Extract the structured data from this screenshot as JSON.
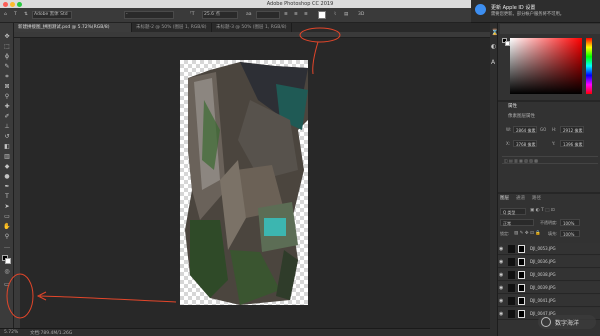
{
  "app": {
    "window_title": "Adobe Photoshop CC 2019"
  },
  "options_bar": {
    "mode_label": "Adobe 黑体 Std",
    "font_style": "-",
    "size_value": "25.6 点"
  },
  "tabs": [
    {
      "label": "新建拼接图_拼图测试.psd @ 5.72%(RGB/8)",
      "active": true
    },
    {
      "label": "未标题-2 @ 50% (图层 1, RGB/8)",
      "active": false
    },
    {
      "label": "未标题-3 @ 50% (图层 1, RGB/8)",
      "active": false
    }
  ],
  "status_bar": {
    "zoom": "5.72%",
    "doc_info": "文档:789.4M/1.26G"
  },
  "notification": {
    "title": "更新 Apple ID 设置",
    "body": "需要您更新。部分帐户服务将不可用。"
  },
  "properties_panel": {
    "title": "属性",
    "subtitle": "像素图层属性",
    "w_label": "W:",
    "w_value": "2864 像素",
    "h_label": "H:",
    "h_value": "2912 像素",
    "x_label": "X:",
    "x_value": "3768 像素",
    "y_label": "Y:",
    "y_value": "1396 像素",
    "link_label": "GO"
  },
  "layers_panel": {
    "tabs": [
      "图层",
      "通道",
      "路径"
    ],
    "filter_label": "Q 类型",
    "blend_mode": "正常",
    "opacity_label": "不透明度:",
    "opacity_value": "100%",
    "lock_label": "锁定:",
    "fill_label": "填充:",
    "fill_value": "100%",
    "layers": [
      "DJI_0053.JPG",
      "DJI_0036.JPG",
      "DJI_0038.JPG",
      "DJI_0039.JPG",
      "DJI_0041.JPG",
      "DJI_0047.JPG"
    ]
  },
  "colors": {
    "accent_red": "#e3462a",
    "panel_bg": "#323232",
    "canvas_bg": "#282828"
  },
  "watermark": "数字海洋"
}
